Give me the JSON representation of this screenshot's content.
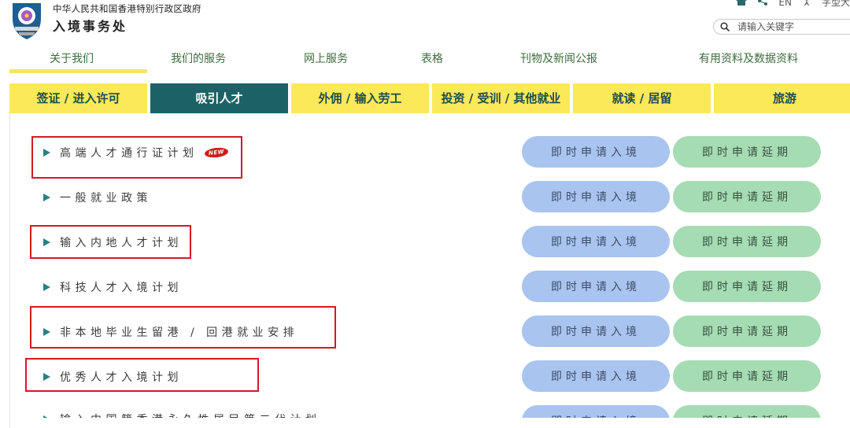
{
  "header": {
    "gov_name": "中华人民共和国香港特别行政区政府",
    "dept_name": "入境事务处",
    "lang_en": "EN",
    "partial_link": "字型大",
    "search_placeholder": "请输入关键字",
    "icons": [
      "home-icon",
      "share-icon",
      "accessibility-icon",
      "search-icon"
    ]
  },
  "nav": {
    "items": [
      "关于我们",
      "我们的服务",
      "网上服务",
      "表格",
      "刊物及新闻公报",
      "有用资料及数据资料"
    ]
  },
  "tabs": {
    "items": [
      "签证 / 进入许可",
      "吸引人才",
      "外佣 / 输入劳工",
      "投资 / 受训 / 其他就业",
      "就读 / 居留",
      "旅游"
    ],
    "active": "吸引人才"
  },
  "schemes": [
    {
      "label": "高端人才通行证计划",
      "new": "NEW",
      "enter": "即时申请入境",
      "extend": "即时申请延期"
    },
    {
      "label": "一般就业政策",
      "enter": "即时申请入境",
      "extend": "即时申请延期"
    },
    {
      "label": "输入内地人才计划",
      "enter": "即时申请入境",
      "extend": "即时申请延期"
    },
    {
      "label": "科技人才入境计划",
      "enter": "即时申请入境",
      "extend": "即时申请延期"
    },
    {
      "label": "非本地毕业生留港 / 回港就业安排",
      "enter": "即时申请入境",
      "extend": "即时申请延期"
    },
    {
      "label": "优秀人才入境计划",
      "enter": "即时申请入境",
      "extend": "即时申请延期"
    },
    {
      "label": "输入中国籍香港永久性居民第二代计划",
      "enter": "即时申请入境",
      "extend": "即时申请延期"
    }
  ],
  "colors": {
    "tab_yellow": "#fce95a",
    "tab_active": "#1c6264",
    "enter_button": "#a9c4ee",
    "extend_button": "#a6dcb3",
    "highlight_box": "#d21a25",
    "bullet": "#2a7f86"
  }
}
